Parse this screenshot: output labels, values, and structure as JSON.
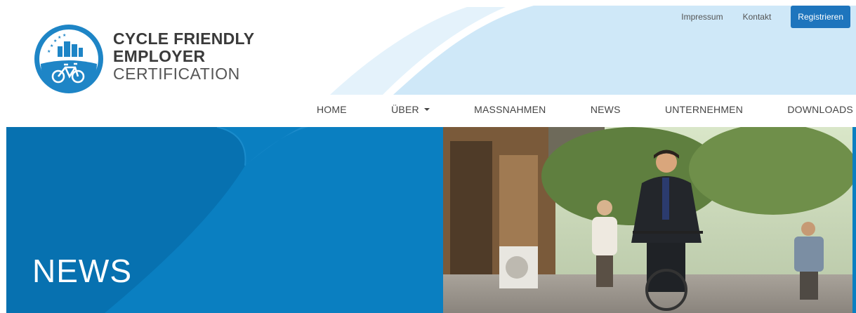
{
  "logo": {
    "line1": "CYCLE FRIENDLY",
    "line2": "EMPLOYER",
    "line3": "CERTIFICATION"
  },
  "topbar": {
    "impressum": "Impressum",
    "kontakt": "Kontakt",
    "register": "Registrieren"
  },
  "nav": {
    "items": [
      {
        "label": "HOME"
      },
      {
        "label": "ÜBER"
      },
      {
        "label": "MASSNAHMEN"
      },
      {
        "label": "NEWS"
      },
      {
        "label": "UNTERNEHMEN"
      },
      {
        "label": "DOWNLOADS"
      }
    ]
  },
  "hero": {
    "title": "NEWS"
  },
  "colors": {
    "brand_blue": "#0a7fc1",
    "button_blue": "#1e75bd",
    "light_blue": "#c9e6f7"
  }
}
